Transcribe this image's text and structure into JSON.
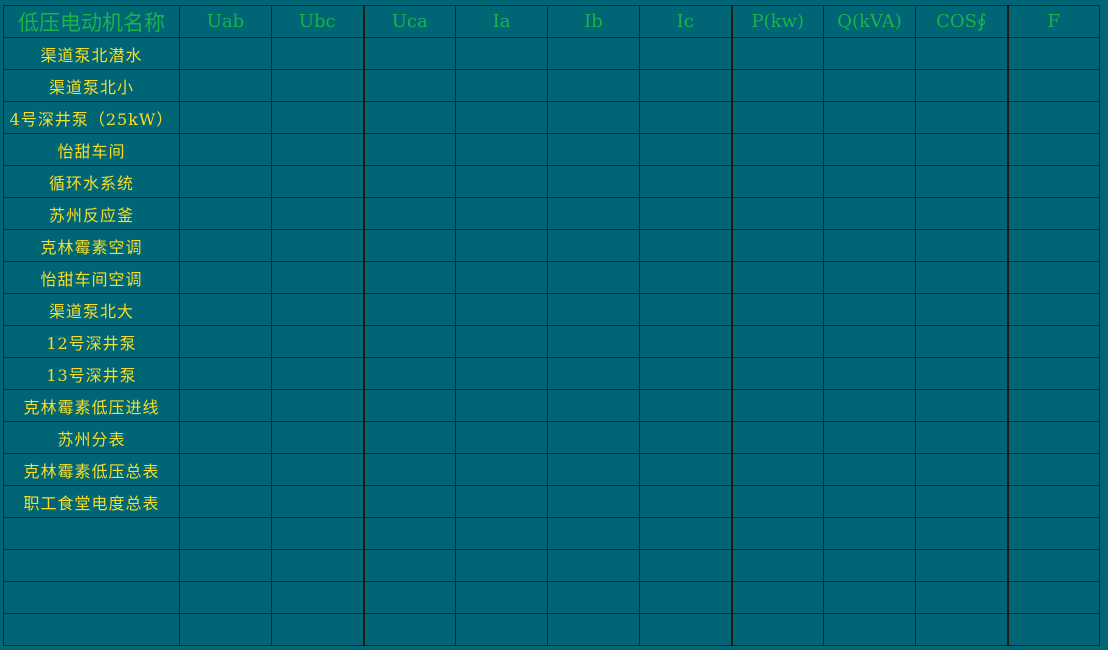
{
  "table": {
    "headers": [
      "低压电动机名称",
      "Uab",
      "Ubc",
      "Uca",
      "Ia",
      "Ib",
      "Ic",
      "P(kw)",
      "Q(kVA)",
      "COS∮",
      "F"
    ],
    "rows": [
      {
        "name": "渠道泵北潜水",
        "values": [
          "",
          "",
          "",
          "",
          "",
          "",
          "",
          "",
          "",
          ""
        ]
      },
      {
        "name": "渠道泵北小",
        "values": [
          "",
          "",
          "",
          "",
          "",
          "",
          "",
          "",
          "",
          ""
        ]
      },
      {
        "name": "4号深井泵（25kW）",
        "values": [
          "",
          "",
          "",
          "",
          "",
          "",
          "",
          "",
          "",
          ""
        ]
      },
      {
        "name": "怡甜车间",
        "values": [
          "",
          "",
          "",
          "",
          "",
          "",
          "",
          "",
          "",
          ""
        ]
      },
      {
        "name": "循环水系统",
        "values": [
          "",
          "",
          "",
          "",
          "",
          "",
          "",
          "",
          "",
          ""
        ]
      },
      {
        "name": "苏州反应釜",
        "values": [
          "",
          "",
          "",
          "",
          "",
          "",
          "",
          "",
          "",
          ""
        ]
      },
      {
        "name": "克林霉素空调",
        "values": [
          "",
          "",
          "",
          "",
          "",
          "",
          "",
          "",
          "",
          ""
        ]
      },
      {
        "name": "怡甜车间空调",
        "values": [
          "",
          "",
          "",
          "",
          "",
          "",
          "",
          "",
          "",
          ""
        ]
      },
      {
        "name": "渠道泵北大",
        "values": [
          "",
          "",
          "",
          "",
          "",
          "",
          "",
          "",
          "",
          ""
        ]
      },
      {
        "name": "12号深井泵",
        "values": [
          "",
          "",
          "",
          "",
          "",
          "",
          "",
          "",
          "",
          ""
        ]
      },
      {
        "name": "13号深井泵",
        "values": [
          "",
          "",
          "",
          "",
          "",
          "",
          "",
          "",
          "",
          ""
        ]
      },
      {
        "name": "克林霉素低压进线",
        "values": [
          "",
          "",
          "",
          "",
          "",
          "",
          "",
          "",
          "",
          ""
        ]
      },
      {
        "name": "苏州分表",
        "values": [
          "",
          "",
          "",
          "",
          "",
          "",
          "",
          "",
          "",
          ""
        ]
      },
      {
        "name": "克林霉素低压总表",
        "values": [
          "",
          "",
          "",
          "",
          "",
          "",
          "",
          "",
          "",
          ""
        ]
      },
      {
        "name": "职工食堂电度总表",
        "values": [
          "",
          "",
          "",
          "",
          "",
          "",
          "",
          "",
          "",
          ""
        ]
      },
      {
        "name": "",
        "values": [
          "",
          "",
          "",
          "",
          "",
          "",
          "",
          "",
          "",
          ""
        ]
      },
      {
        "name": "",
        "values": [
          "",
          "",
          "",
          "",
          "",
          "",
          "",
          "",
          "",
          ""
        ]
      },
      {
        "name": "",
        "values": [
          "",
          "",
          "",
          "",
          "",
          "",
          "",
          "",
          "",
          ""
        ]
      },
      {
        "name": "",
        "values": [
          "",
          "",
          "",
          "",
          "",
          "",
          "",
          "",
          "",
          ""
        ]
      }
    ]
  },
  "colors": {
    "background": "#006675",
    "header_text": "#19b34a",
    "row_text": "#f5de2a",
    "grid_lines": "#242424"
  }
}
